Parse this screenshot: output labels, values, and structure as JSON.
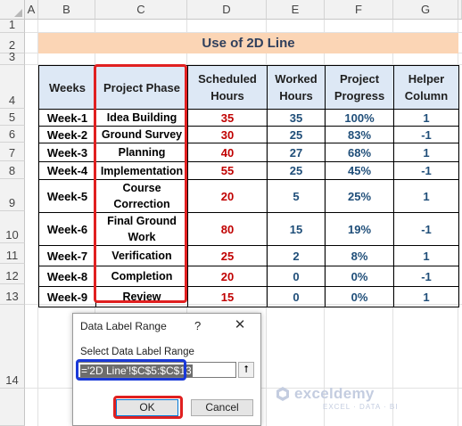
{
  "sheet": {
    "columns": [
      "A",
      "B",
      "C",
      "D",
      "E",
      "F",
      "G"
    ],
    "rows": [
      "1",
      "2",
      "3",
      "4",
      "5",
      "6",
      "7",
      "8",
      "9",
      "10",
      "11",
      "12",
      "13",
      "14"
    ]
  },
  "title": "Use of 2D Line",
  "table": {
    "headers": {
      "weeks": "Weeks",
      "phase": "Project Phase",
      "scheduled": "Scheduled Hours",
      "worked": "Worked Hours",
      "progress": "Project Progress",
      "helper": "Helper Column"
    },
    "rows": [
      {
        "week": "Week-1",
        "phase": "Idea Building",
        "scheduled": "35",
        "worked": "35",
        "progress": "100%",
        "helper": "1"
      },
      {
        "week": "Week-2",
        "phase": "Ground Survey",
        "scheduled": "30",
        "worked": "25",
        "progress": "83%",
        "helper": "-1"
      },
      {
        "week": "Week-3",
        "phase": "Planning",
        "scheduled": "40",
        "worked": "27",
        "progress": "68%",
        "helper": "1"
      },
      {
        "week": "Week-4",
        "phase": "Implementation",
        "scheduled": "55",
        "worked": "25",
        "progress": "45%",
        "helper": "-1"
      },
      {
        "week": "Week-5",
        "phase": "Course Correction",
        "scheduled": "20",
        "worked": "5",
        "progress": "25%",
        "helper": "1"
      },
      {
        "week": "Week-6",
        "phase": "Final Ground Work",
        "scheduled": "80",
        "worked": "15",
        "progress": "19%",
        "helper": "-1"
      },
      {
        "week": "Week-7",
        "phase": "Verification",
        "scheduled": "25",
        "worked": "2",
        "progress": "8%",
        "helper": "1"
      },
      {
        "week": "Week-8",
        "phase": "Completion",
        "scheduled": "20",
        "worked": "0",
        "progress": "0%",
        "helper": "-1"
      },
      {
        "week": "Week-9",
        "phase": "Review",
        "scheduled": "15",
        "worked": "0",
        "progress": "0%",
        "helper": "1"
      }
    ]
  },
  "dialog": {
    "title": "Data Label Range",
    "help": "?",
    "close": "✕",
    "label": "Select Data Label Range",
    "input_value": "='2D Line'!$C$5:$C$13",
    "collapse_icon": "⭡",
    "ok_label": "OK",
    "cancel_label": "Cancel"
  },
  "watermark": {
    "name": "exceldemy",
    "tagline": "EXCEL · DATA · BI"
  },
  "colors": {
    "title_fill": "#fbd5b5",
    "header_fill": "#dde8f5",
    "highlight_red": "#e02020",
    "highlight_blue": "#1a39d8"
  }
}
